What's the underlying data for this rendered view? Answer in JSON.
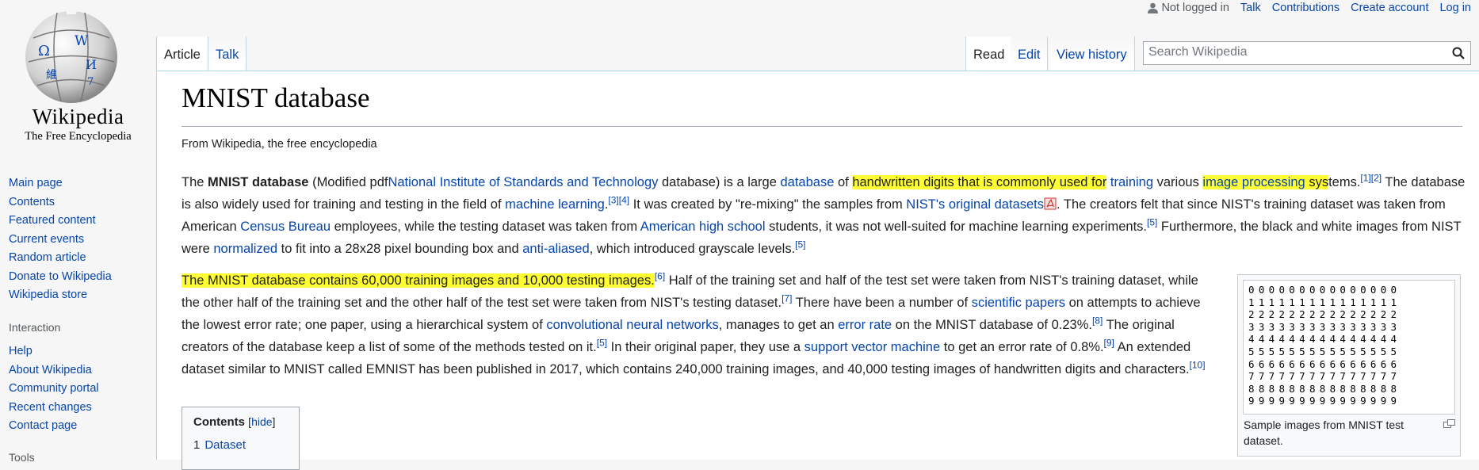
{
  "logo": {
    "wordmark": "Wikipedia",
    "tagline": "The Free Encyclopedia",
    "globe_letters": [
      "Ω",
      "W",
      "И",
      "維",
      "7"
    ]
  },
  "sidebar": {
    "nav": [
      "Main page",
      "Contents",
      "Featured content",
      "Current events",
      "Random article",
      "Donate to Wikipedia",
      "Wikipedia store"
    ],
    "interaction_heading": "Interaction",
    "interaction": [
      "Help",
      "About Wikipedia",
      "Community portal",
      "Recent changes",
      "Contact page"
    ],
    "tools_heading": "Tools"
  },
  "personal_tools": {
    "user": "Not logged in",
    "talk": "Talk",
    "contributions": "Contributions",
    "create_account": "Create account",
    "login": "Log in"
  },
  "tabs": {
    "article": "Article",
    "talk": "Talk",
    "read": "Read",
    "edit": "Edit",
    "history": "View history"
  },
  "search": {
    "placeholder": "Search Wikipedia",
    "icon": "search-icon"
  },
  "article": {
    "title": "MNIST database",
    "tagline": "From Wikipedia, the free encyclopedia",
    "p1": {
      "t1": "The ",
      "bold": "MNIST database",
      "t2": " (Modified pdf",
      "l_nist": "National Institute of Standards and Technology",
      "t3": " database) is a large ",
      "l_database": "database",
      "t4": " of ",
      "hl1": "handwritten digits that is commonly used for",
      "t5": " ",
      "l_training": "training",
      "t6": " various ",
      "l_image": "image processing",
      "hl_tail": " sys",
      "t7": "tems.",
      "ref12": "[1][2]",
      "t8": " The database is also widely used for training and testing in the field of ",
      "l_ml": "machine learning",
      "t9": ".",
      "ref34": "[3][4]",
      "t10": " It was created by \"re-mixing\" the samples from ",
      "l_nistorig": "NIST's original datasets",
      "t11": ". The creators felt that since NIST's training dataset was taken from American ",
      "l_census": "Census Bureau",
      "t12": " employees, while the testing dataset was taken from ",
      "l_school": "American high school",
      "t13": " students, it was not well-suited for machine learning experiments.",
      "ref5a": "[5]",
      "t14": " Furthermore, the black and white images from NIST were ",
      "l_norm": "normalized",
      "t15": " to fit into a 28x28 pixel bounding box and ",
      "l_anti": "anti-aliased",
      "t16": ", which introduced grayscale levels.",
      "ref5b": "[5]"
    },
    "p2": {
      "hl": "The MNIST database contains 60,000 training images and 10,000 testing images.",
      "ref6": "[6]",
      "t1": " Half of the training set and half of the test set were taken from NIST's training dataset, while the other half of the training set and the other half of the test set were taken from NIST's testing dataset.",
      "ref7": "[7]",
      "t2": " There have been a number of ",
      "l_sci": "scientific papers",
      "t3": " on attempts to achieve the lowest error rate; one paper, using a hierarchical system of ",
      "l_cnn": "convolutional neural networks",
      "t4": ", manages to get an ",
      "l_err": "error rate",
      "t5": " on the MNIST database of 0.23%.",
      "ref8": "[8]",
      "t6": " The original creators of the database keep a list of some of the methods tested on it.",
      "ref5": "[5]",
      "t7": " In their original paper, they use a ",
      "l_svm": "support vector machine",
      "t8": " to get an error rate of 0.8%.",
      "ref9": "[9]",
      "t9": " An extended dataset similar to MNIST called EMNIST has been published in 2017, which contains 240,000 training images, and 40,000 testing images of handwritten digits and characters.",
      "ref10": "[10]"
    },
    "thumb_caption": "Sample images from MNIST test dataset.",
    "thumb_digits": "000000000000000\n111111111111111\n222222222222222\n333333333333333\n444444444444444\n555555555555555\n666666666666666\n777777777777777\n888888888888888\n999999999999999",
    "toc": {
      "title": "Contents",
      "hide": "hide",
      "item_num": "1",
      "item": "Dataset"
    }
  },
  "colors": {
    "link": "#0645ad",
    "highlight": "#ffff33",
    "border": "#a7d7f9"
  }
}
